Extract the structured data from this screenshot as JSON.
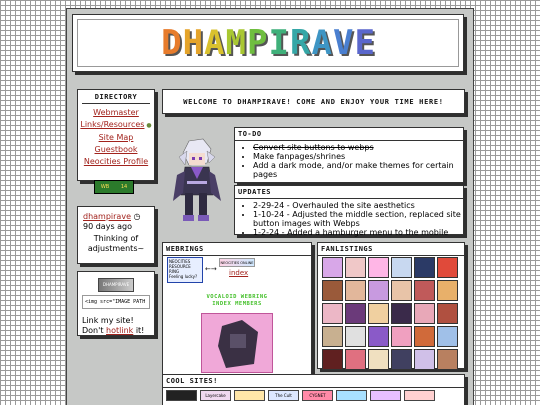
{
  "header": {
    "logo_letters": [
      "D",
      "H",
      "A",
      "M",
      "P",
      "I",
      "R",
      "A",
      "V",
      "E"
    ],
    "logo_colors": [
      "#e77c2c",
      "#e5a42a",
      "#d9c12e",
      "#a9c832",
      "#6fbe3f",
      "#3fb07a",
      "#35a7a7",
      "#3e95c4",
      "#4a7fd0",
      "#5a67cc"
    ]
  },
  "directory": {
    "title": "DIRECTORY",
    "items": [
      "Webmaster",
      "Links/Resources",
      "Site Map",
      "Guestbook",
      "Neocities Profile"
    ]
  },
  "badge": {
    "left": "WB",
    "right": "14"
  },
  "status": {
    "user": "dhampirave",
    "time": "90 days ago",
    "text": "Thinking of adjustments~"
  },
  "linkme": {
    "button_text": "DHAMPIRAVE",
    "code": "<img src=\"IMAGE PATH",
    "text_before": "Link my site! Don't",
    "hotlink": "hotlink",
    "text_after": "it!"
  },
  "welcome": {
    "text": "WELCOME TO DHAMPIRAVE! COME AND ENJOY YOUR TIME HERE!"
  },
  "todo": {
    "title": "TO-DO",
    "items": [
      {
        "text": "Convert site buttons to webps",
        "done": true
      },
      {
        "text": "Make fanpages/shrines",
        "done": false
      },
      {
        "text": "Add a dark mode, and/or make themes for certain pages",
        "done": false
      }
    ]
  },
  "updates": {
    "title": "UPDATES",
    "items": [
      "2-29-24 - Overhauled the site aesthetics",
      "1-10-24 - Adjusted the middle section, replaced site button images with Webps",
      "1-2-24 - Added a hamburger menu to the mobile"
    ]
  },
  "webrings": {
    "title": "WEBRINGS",
    "ring_box_text": "NEOCITIES RESOURCE RING",
    "ring_box_sub": "Feeling lucky?",
    "ring_img_text": "NEOCITIES ONLINE",
    "index_label": "index",
    "vocaloid_title": "VOCALOID WEBRING",
    "vocaloid_links": "INDEX  MEMBERS"
  },
  "fanlistings": {
    "title": "FANLISTINGS",
    "colors": [
      "#d8a7e8",
      "#f0c8c8",
      "#ffb6e6",
      "#c8d8f0",
      "#2b3a66",
      "#e04a3a",
      "#9a5a3a",
      "#e2b79b",
      "#c89ae0",
      "#e8c4a8",
      "#c05a5a",
      "#e8b06a",
      "#ecb7c6",
      "#6b3a7a",
      "#f0d0a0",
      "#3a2a4a",
      "#e8a8b8",
      "#b05040",
      "#c8b090",
      "#e0e0e0",
      "#8a5ac8",
      "#f0a0c0",
      "#d06a3a",
      "#a0c0e8",
      "#602020",
      "#e07080",
      "#f0e0c0",
      "#404060",
      "#d0c0e8",
      "#b88060"
    ]
  },
  "cool_sites": {
    "title": "COOL SITES!",
    "items": [
      "",
      "Layercake",
      "",
      "The Cult",
      "CYGNET",
      "",
      "",
      ""
    ],
    "colors": [
      "#222222",
      "#f0d8f0",
      "#ffe6a8",
      "#dde8ff",
      "#ff8aa8",
      "#a8e0ff",
      "#e8c0ff",
      "#ffd0d0"
    ]
  }
}
